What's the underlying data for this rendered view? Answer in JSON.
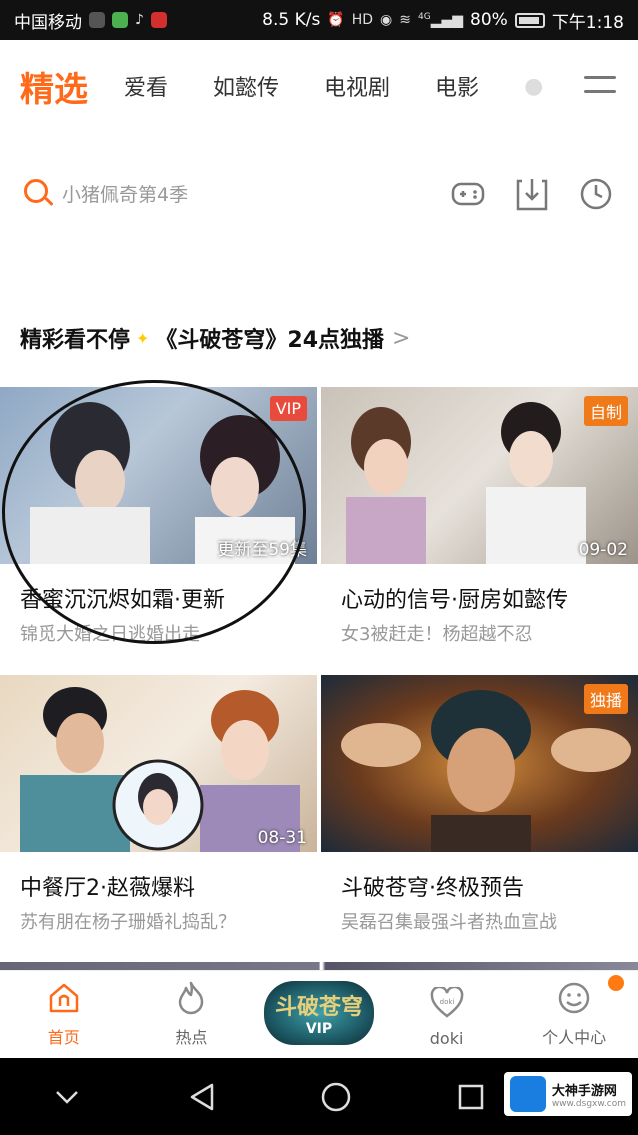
{
  "status_bar": {
    "carrier": "中国移动",
    "speed": "8.5 K/s",
    "signal": "4G",
    "battery": "80%",
    "time": "下午1:18"
  },
  "top_nav": {
    "tabs": [
      "精选",
      "爱看",
      "如懿传",
      "电视剧",
      "电影"
    ],
    "active_color": "#ff6a1a"
  },
  "search": {
    "placeholder": "小猪佩奇第4季"
  },
  "section": {
    "title": "精彩看不停",
    "highlight": "《斗破苍穹》24点独播",
    "chevron": ">"
  },
  "cards": [
    {
      "badge": "VIP",
      "badge_color": "#e84a3c",
      "overlay": "更新至59集",
      "title": "香蜜沉沉烬如霜·更新",
      "subtitle": "锦觅大婚之日逃婚出走"
    },
    {
      "badge": "自制",
      "badge_color": "#f07a1a",
      "overlay": "09-02",
      "title": "心动的信号·厨房如懿传",
      "subtitle": "女3被赶走！杨超越不忍"
    },
    {
      "badge": "",
      "badge_color": "",
      "overlay": "08-31",
      "title": "中餐厅2·赵薇爆料",
      "subtitle": "苏有朋在杨子珊婚礼捣乱？"
    },
    {
      "badge": "独播",
      "badge_color": "#f07a1a",
      "overlay": "",
      "title": "斗破苍穹·终极预告",
      "subtitle": "吴磊召集最强斗者热血宣战"
    }
  ],
  "bottom_bar": {
    "items": [
      {
        "label": "首页",
        "icon": "home-icon"
      },
      {
        "label": "热点",
        "icon": "flame-icon"
      },
      {
        "label": "VIP",
        "icon": "vip-logo"
      },
      {
        "label": "doki",
        "icon": "doki-icon"
      },
      {
        "label": "个人中心",
        "icon": "face-icon"
      }
    ],
    "vip_logo_text": "斗破苍穹"
  },
  "watermark": {
    "name": "大神手游网",
    "url": "www.dsgxw.com"
  }
}
